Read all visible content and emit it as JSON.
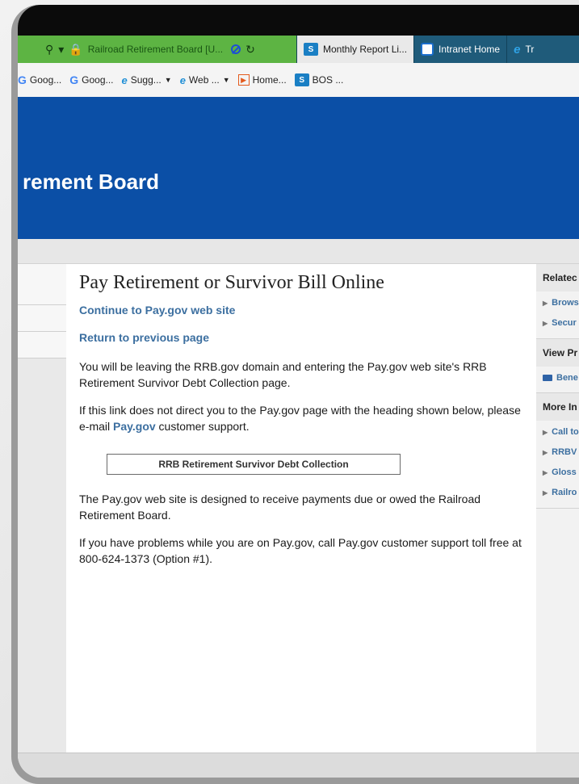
{
  "browser": {
    "address": {
      "url_text": "Railroad Retirement Board [U...",
      "search_glyph": "⚲",
      "dropdown_glyph": "▾",
      "lock_glyph": "🔒",
      "refresh_glyph": "↻"
    },
    "tabs": [
      {
        "label": "Monthly Report Li...",
        "icon": "sharepoint-icon"
      },
      {
        "label": "Intranet Home",
        "icon": "intranet-icon"
      },
      {
        "label": "Tr",
        "icon": "ie-icon"
      }
    ],
    "favorites": [
      {
        "label": "Goog...",
        "icon": "google-icon"
      },
      {
        "label": "Goog...",
        "icon": "google-icon"
      },
      {
        "label": "Sugg...",
        "icon": "ie-icon"
      },
      {
        "label": "Web ...",
        "icon": "ie-icon"
      },
      {
        "label": "Home...",
        "icon": "home-icon"
      },
      {
        "label": "BOS ...",
        "icon": "sharepoint-icon"
      }
    ]
  },
  "banner": {
    "title": "rement Board"
  },
  "main": {
    "heading": "Pay Retirement or Survivor Bill Online",
    "continue_link": "Continue to Pay.gov web site",
    "return_link": "Return to previous page",
    "p1": "You will be leaving the RRB.gov domain and entering the Pay.gov web site's RRB Retirement Survivor Debt Collection page.",
    "p2_before": "If this link does not direct you to the Pay.gov page with the heading shown below, please e-mail ",
    "p2_link": "Pay.gov",
    "p2_after": " customer support.",
    "box_label": "RRB Retirement Survivor Debt Collection",
    "p3": "The Pay.gov web site is designed to receive payments due or owed the Railroad Retirement Board.",
    "p4": "If you have problems while you are on Pay.gov, call Pay.gov customer support toll free at 800-624-1373 (Option #1)."
  },
  "right": {
    "related_heading": "Relatec",
    "related_items": [
      "Brows",
      "Secur"
    ],
    "view_heading": "View Pr",
    "view_item": "Bene",
    "more_heading": "More In",
    "more_items": [
      "Call to Telep",
      "RRBV",
      "Gloss",
      "Railro"
    ]
  },
  "colors": {
    "banner": "#0b4fa6",
    "tabbar": "#1f5b7a",
    "address": "#5db443",
    "link": "#3c6fa0"
  }
}
